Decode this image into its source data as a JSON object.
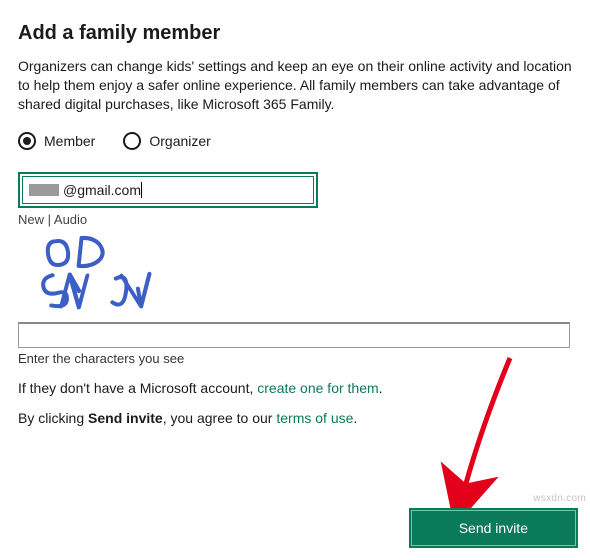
{
  "title": "Add a family member",
  "description": "Organizers can change kids' settings and keep an eye on their online activity and location to help them enjoy a safer online experience. All family members can take advantage of shared digital purchases, like Microsoft 365 Family.",
  "role": {
    "member_label": "Member",
    "organizer_label": "Organizer",
    "selected": "member"
  },
  "email": {
    "visible_part": "@gmail.com",
    "selected_prefix": " "
  },
  "captcha": {
    "new_label": "New",
    "sep": " | ",
    "audio_label": "Audio",
    "image_text": "PD SMY",
    "hint": "Enter the characters you see"
  },
  "no_account": {
    "prefix": "If they don't have a Microsoft account, ",
    "link": "create one for them",
    "suffix": "."
  },
  "agree": {
    "prefix": "By clicking ",
    "bold": "Send invite",
    "mid": ", you agree to our ",
    "link": "terms of use",
    "suffix": "."
  },
  "send_button": "Send invite",
  "watermark": "wsxdn.com"
}
